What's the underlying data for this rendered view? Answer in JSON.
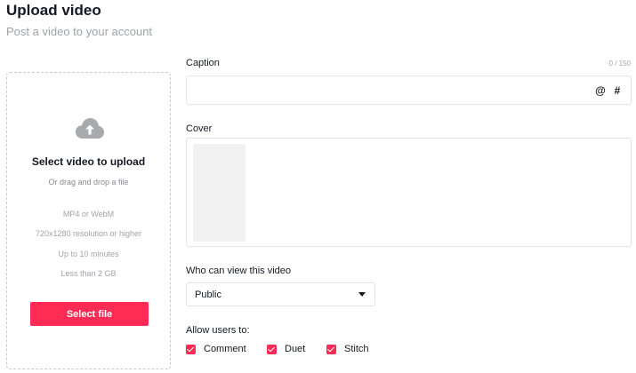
{
  "header": {
    "title": "Upload video",
    "subtitle": "Post a video to your account"
  },
  "upload": {
    "icon": "cloud-upload-icon",
    "title": "Select video to upload",
    "drag_text": "Or drag and drop a file",
    "requirements": [
      "MP4 or WebM",
      "720x1280 resolution or higher",
      "Up to 10 minutes",
      "Less than 2 GB"
    ],
    "button_label": "Select file"
  },
  "caption": {
    "label": "Caption",
    "counter": "0 / 150",
    "value": "",
    "mention_symbol": "@",
    "hashtag_symbol": "#"
  },
  "cover": {
    "label": "Cover"
  },
  "privacy": {
    "label": "Who can view this video",
    "selected": "Public"
  },
  "permissions": {
    "label": "Allow users to:",
    "items": [
      {
        "label": "Comment",
        "checked": true
      },
      {
        "label": "Duet",
        "checked": true
      },
      {
        "label": "Stitch",
        "checked": true
      }
    ]
  },
  "colors": {
    "accent": "#fe2c55",
    "text": "#161823",
    "muted": "#a3a4aa",
    "border": "#e3e3e4"
  }
}
